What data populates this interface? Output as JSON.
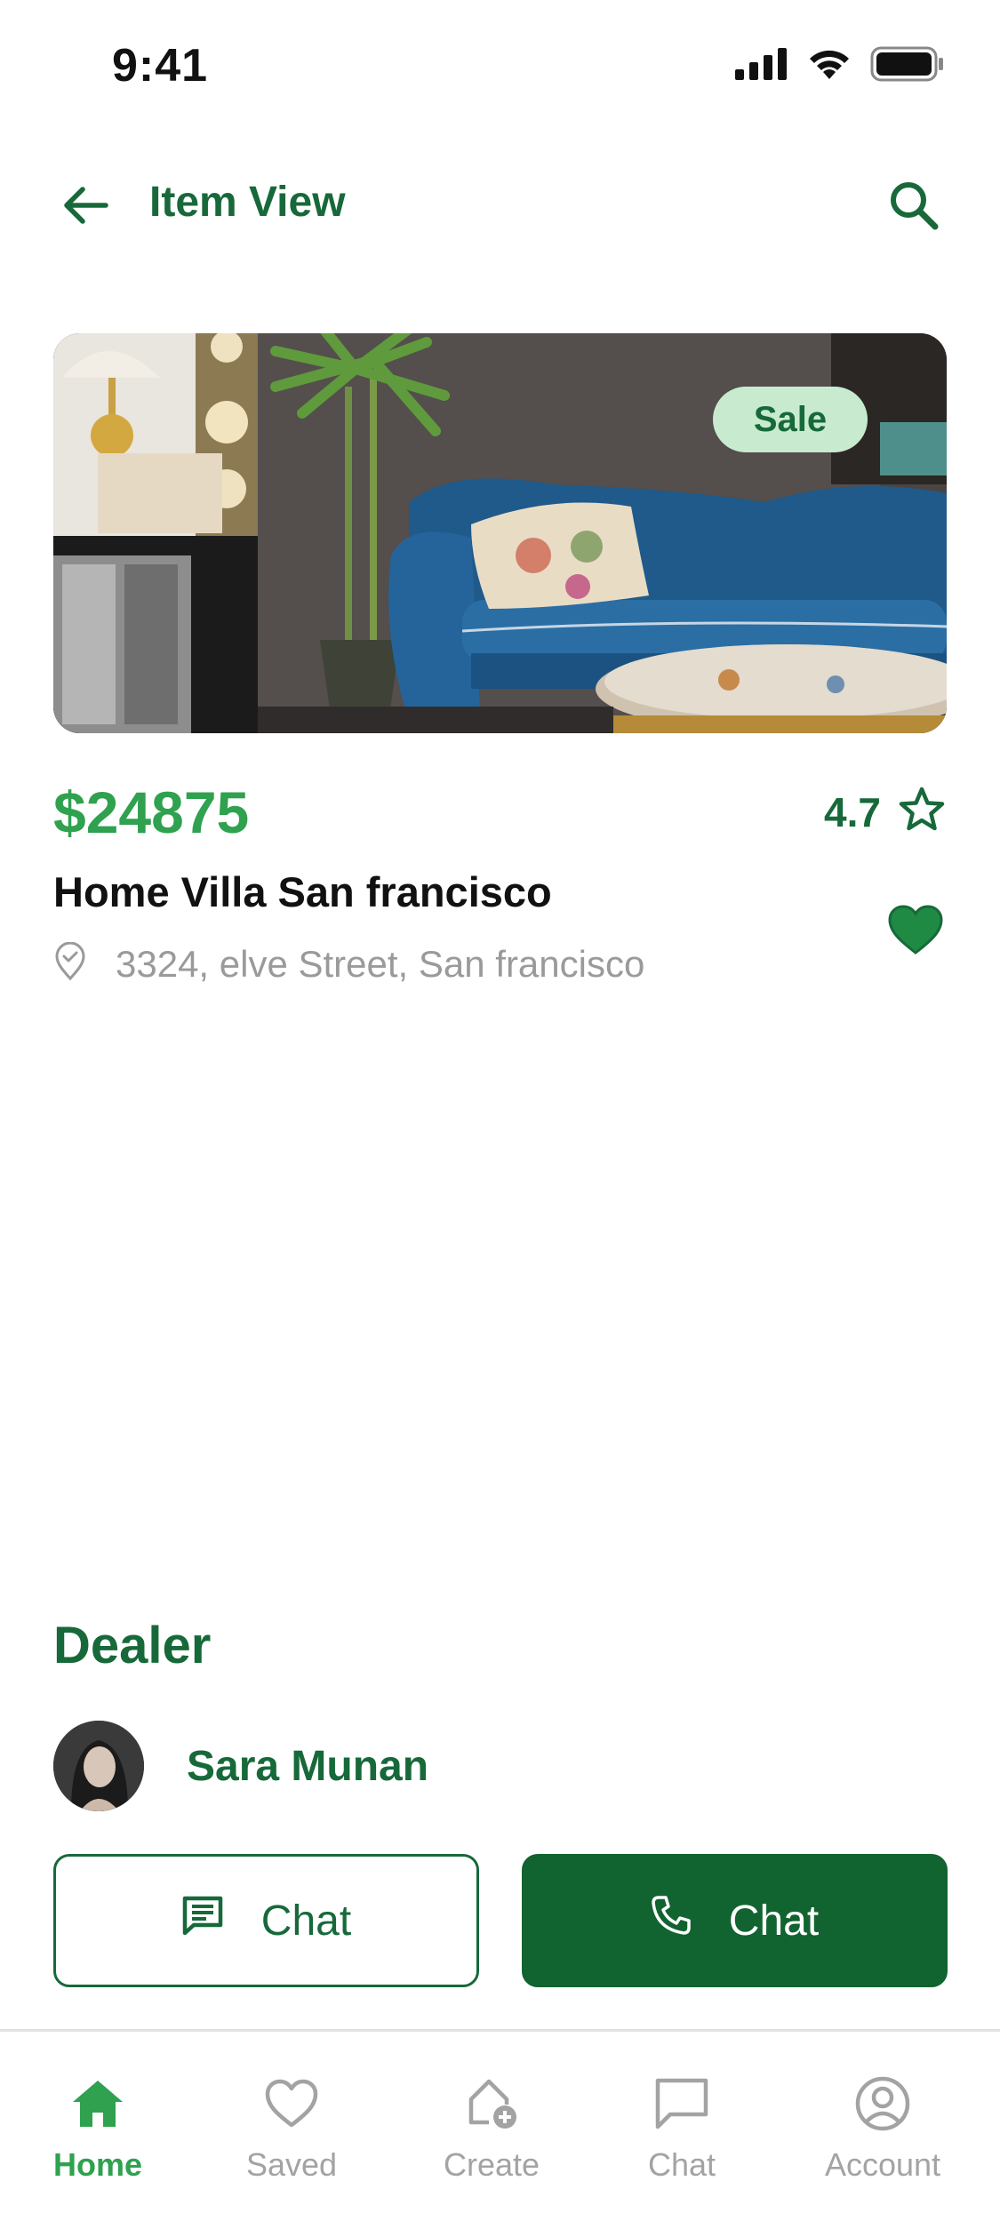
{
  "status_bar": {
    "time": "9:41"
  },
  "header": {
    "title": "Item View"
  },
  "listing": {
    "badge": "Sale",
    "price": "$24875",
    "rating": "4.7",
    "title": "Home Villa San francisco",
    "address": "3324, elve Street, San francisco"
  },
  "dealer": {
    "heading": "Dealer",
    "name": "Sara Munan"
  },
  "actions": {
    "chat_label": "Chat",
    "call_label": "Chat"
  },
  "bottom_nav": {
    "items": [
      {
        "label": "Home",
        "icon": "home-icon",
        "active": true
      },
      {
        "label": "Saved",
        "icon": "heart-outline-icon",
        "active": false
      },
      {
        "label": "Create",
        "icon": "create-home-icon",
        "active": false
      },
      {
        "label": "Chat",
        "icon": "chat-bubble-icon",
        "active": false
      },
      {
        "label": "Account",
        "icon": "account-icon",
        "active": false
      }
    ]
  },
  "colors": {
    "primary": "#17693a",
    "primary_dark": "#11632f",
    "accent": "#2fa14f",
    "badge_bg": "#c8ebd0",
    "muted": "#a3a3a3"
  }
}
